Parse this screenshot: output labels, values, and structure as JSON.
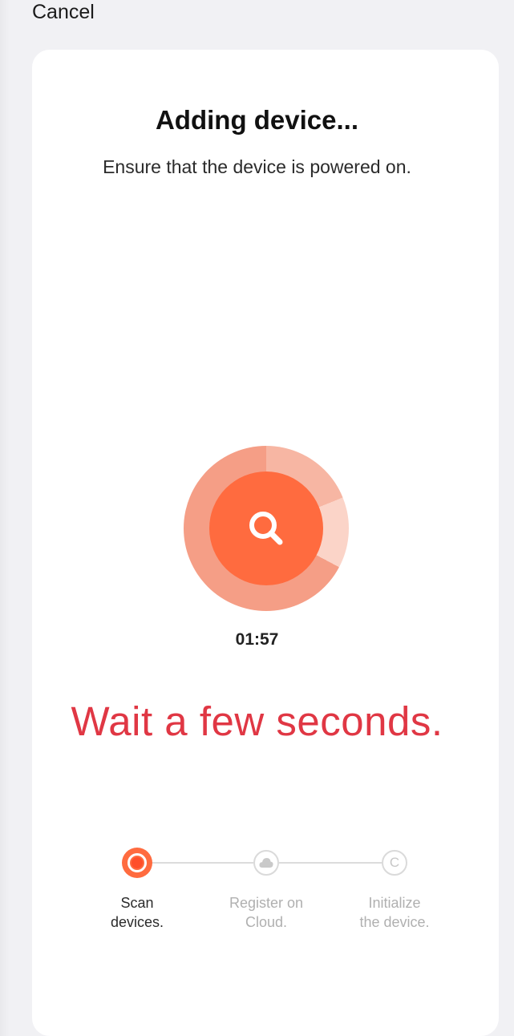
{
  "header": {
    "cancel_label": "Cancel"
  },
  "card": {
    "title": "Adding device...",
    "subtitle": "Ensure that the device is powered on."
  },
  "scan": {
    "icon": "search-icon",
    "timer": "01:57"
  },
  "overlay": {
    "message": "Wait a few seconds."
  },
  "steps": [
    {
      "line1": "Scan",
      "line2": "devices.",
      "state": "active",
      "icon": "scan-active-icon"
    },
    {
      "line1": "Register on",
      "line2": "Cloud.",
      "state": "pending",
      "icon": "cloud-icon"
    },
    {
      "line1": "Initialize",
      "line2": "the device.",
      "state": "pending",
      "icon": "c-circle-icon",
      "icon_glyph": "C"
    }
  ],
  "colors": {
    "accent": "#ff6b3f",
    "overlay_text": "#e03744",
    "inactive_text": "#b0b0b0",
    "active_text": "#2b2b2b"
  }
}
